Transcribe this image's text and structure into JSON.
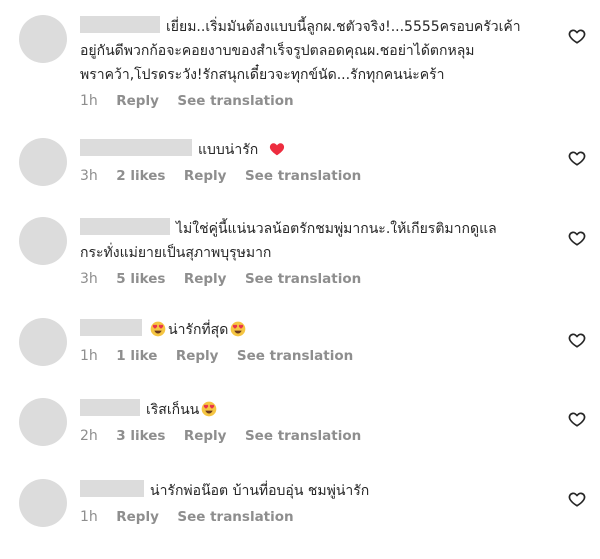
{
  "comments": [
    {
      "text_lines": [
        "เยี่ยม..เริ่มมันต้องแบบนี้ลูกผ.ชตัวจริง!...5555ครอบครัวเค้า",
        "อยู่กันดีพวกก้อจะคอยงาบของสำเร็จรูปตลอดคุณผ.ชอย่าได้ตกหลุม",
        "พราคว้า,โปรดระวัง!รักสนุกเดี๋ยวจะทุกข์นัด...รักทุกคนน่ะคร้า"
      ],
      "time": "1h",
      "likes": "",
      "reply": "Reply",
      "translate": "See translation"
    },
    {
      "text_lines": [
        "แบบน่ารัก"
      ],
      "time": "3h",
      "likes": "2 likes",
      "reply": "Reply",
      "translate": "See translation"
    },
    {
      "text_lines": [
        "ไม่ใช่คู่นี้แน่นวลน้อตรักชมพู่มากนะ.ให้เกียรติมากดูแล",
        "กระทั่งแม่ยายเป็นสุภาพบุรุษมาก"
      ],
      "time": "3h",
      "likes": "5 likes",
      "reply": "Reply",
      "translate": "See translation"
    },
    {
      "text_lines": [
        "น่ารักที่สุด"
      ],
      "time": "1h",
      "likes": "1 like",
      "reply": "Reply",
      "translate": "See translation"
    },
    {
      "text_lines": [
        "เริสเก็นน"
      ],
      "time": "2h",
      "likes": "3 likes",
      "reply": "Reply",
      "translate": "See translation"
    },
    {
      "text_lines": [
        "น่ารักพ่อน๊อต บ้านที่อบอุ่น ชมพู่น่ารัก"
      ],
      "time": "1h",
      "likes": "",
      "reply": "Reply",
      "translate": "See translation"
    }
  ],
  "icons": {
    "like": "heart-outline-icon",
    "red_heart": "red-heart-emoji",
    "heart_eyes": "heart-eyes-emoji"
  },
  "colors": {
    "text": "#262626",
    "muted": "#8e8e8e",
    "placeholder": "#dcdcdc",
    "heart": "#ed2d3f",
    "emoji_face": "#f5c542"
  }
}
